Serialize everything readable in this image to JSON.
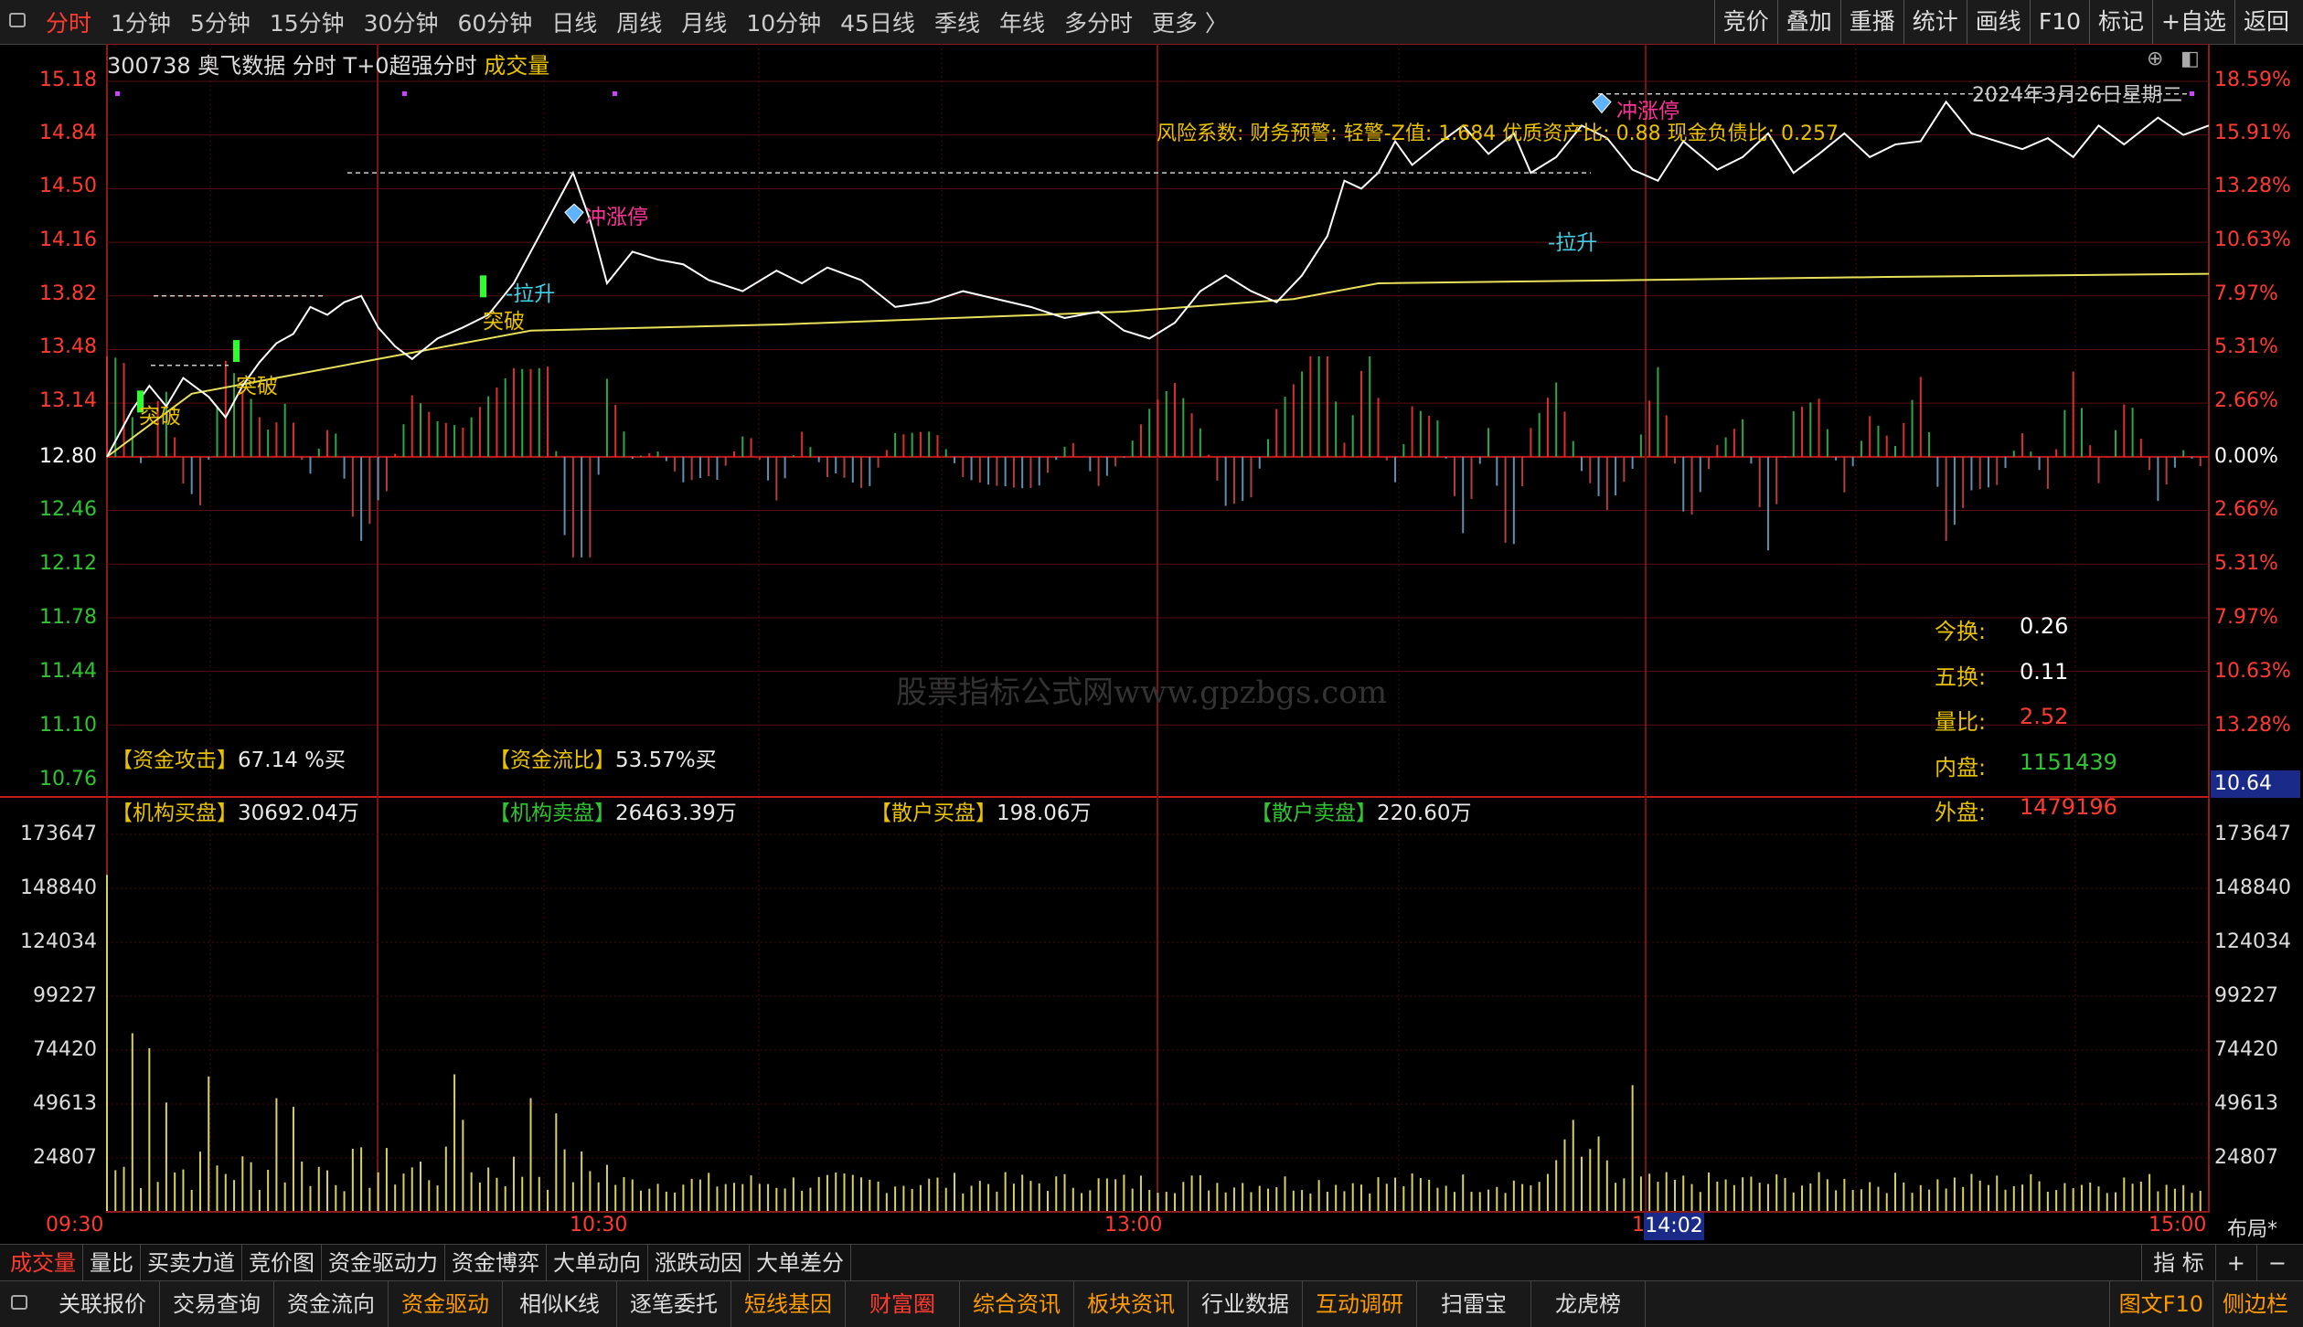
{
  "toolbar": {
    "periods": [
      "分时",
      "1分钟",
      "5分钟",
      "15分钟",
      "30分钟",
      "60分钟",
      "日线",
      "周线",
      "月线",
      "10分钟",
      "45日线",
      "季线",
      "年线",
      "多分时",
      "更多 〉"
    ],
    "active_period": 0,
    "right_tools": [
      "竞价",
      "叠加",
      "重播",
      "统计",
      "画线",
      "F10",
      "标记",
      "+自选",
      "返回"
    ]
  },
  "stock": {
    "code": "300738",
    "name": "奥飞数据",
    "mode": "分时 T+0超强分时",
    "indicator": "成交量"
  },
  "date": "2024年3月26日星期二",
  "risk_text": "风险系数: 财务预警: 轻警-Z值: 1.684 优质资产比: 0.88 现金负债比: 0.257",
  "price_axis": {
    "prices": [
      "15.18",
      "14.84",
      "14.50",
      "14.16",
      "13.82",
      "13.48",
      "13.14",
      "12.80",
      "12.46",
      "12.12",
      "11.78",
      "11.44",
      "11.10",
      "10.76"
    ],
    "percents": [
      "18.59%",
      "15.91%",
      "13.28%",
      "10.63%",
      "7.97%",
      "5.31%",
      "2.66%",
      "0.00%",
      "2.66%",
      "5.31%",
      "7.97%",
      "10.63%",
      "13.28%"
    ],
    "price_colors": {
      "up": "#ff3b30",
      "flat": "#ffffff",
      "down": "#31c431"
    }
  },
  "signals": [
    {
      "text": "突破",
      "color": "#e8c200"
    },
    {
      "text": "突破",
      "color": "#e8c200"
    },
    {
      "text": "突破",
      "color": "#e8c200"
    },
    {
      "text": "拉升",
      "color": "#3fd0e8"
    },
    {
      "text": "冲涨停",
      "color": "#ff3399"
    },
    {
      "text": "拉升",
      "color": "#3fd0e8"
    },
    {
      "text": "冲涨停",
      "color": "#ff3399"
    }
  ],
  "stats": [
    {
      "label": "今换:",
      "value": "0.26",
      "color": "#ffffff"
    },
    {
      "label": "五换:",
      "value": "0.11",
      "color": "#ffffff"
    },
    {
      "label": "量比:",
      "value": "2.52",
      "color": "#ff3b30"
    },
    {
      "label": "内盘:",
      "value": "1151439",
      "color": "#31c431"
    },
    {
      "label": "外盘:",
      "value": "1479196",
      "color": "#ff3b30"
    }
  ],
  "funds": {
    "attack": {
      "label": "【资金攻击】",
      "value": "67.14 %买"
    },
    "flow": {
      "label": "【资金流比】",
      "value": "53.57%买"
    },
    "inst_buy": {
      "label": "【机构买盘】",
      "value": "30692.04万"
    },
    "inst_sell": {
      "label": "【机构卖盘】",
      "value": "26463.39万"
    },
    "retail_buy": {
      "label": "【散户买盘】",
      "value": "198.06万"
    },
    "retail_sell": {
      "label": "【散户卖盘】",
      "value": "220.60万"
    }
  },
  "watermark": "股票指标公式网www.gpzbgs.com",
  "cursor": {
    "price": "10.64",
    "time": "14:02"
  },
  "volume_axis": [
    "173647",
    "148840",
    "124034",
    "99227",
    "74420",
    "49613",
    "24807"
  ],
  "time_axis": [
    "09:30",
    "10:30",
    "13:00",
    "1",
    "15:00"
  ],
  "layout_label": "布局*",
  "indicator_tabs": [
    "成交量",
    "量比",
    "买卖力道",
    "竞价图",
    "资金驱动力",
    "资金博弈",
    "大单动向",
    "涨跌动因",
    "大单差分"
  ],
  "indicator_right": [
    "指 标",
    "+",
    "−"
  ],
  "function_tabs": [
    {
      "label": "关联报价",
      "color": "#dddddd"
    },
    {
      "label": "交易查询",
      "color": "#dddddd"
    },
    {
      "label": "资金流向",
      "color": "#dddddd"
    },
    {
      "label": "资金驱动",
      "color": "#ff9b00"
    },
    {
      "label": "相似K线",
      "color": "#dddddd"
    },
    {
      "label": "逐笔委托",
      "color": "#dddddd"
    },
    {
      "label": "短线基因",
      "color": "#ff9b00"
    },
    {
      "label": "财富圈",
      "color": "#ff3b30"
    },
    {
      "label": "综合资讯",
      "color": "#ff9b00"
    },
    {
      "label": "板块资讯",
      "color": "#ff9b00"
    },
    {
      "label": "行业数据",
      "color": "#dddddd"
    },
    {
      "label": "互动调研",
      "color": "#ff9b00"
    },
    {
      "label": "扫雷宝",
      "color": "#dddddd"
    },
    {
      "label": "龙虎榜",
      "color": "#dddddd"
    }
  ],
  "function_right": [
    "图文F10",
    "侧边栏"
  ],
  "chart_data": {
    "type": "line",
    "prev_close": 12.8,
    "ylim": [
      10.76,
      15.18
    ],
    "price_series": [
      [
        0,
        12.8
      ],
      [
        6,
        13.1
      ],
      [
        10,
        13.25
      ],
      [
        14,
        13.12
      ],
      [
        18,
        13.3
      ],
      [
        24,
        13.18
      ],
      [
        28,
        13.05
      ],
      [
        32,
        13.25
      ],
      [
        36,
        13.4
      ],
      [
        40,
        13.52
      ],
      [
        44,
        13.58
      ],
      [
        48,
        13.75
      ],
      [
        52,
        13.7
      ],
      [
        56,
        13.78
      ],
      [
        60,
        13.82
      ],
      [
        64,
        13.62
      ],
      [
        68,
        13.5
      ],
      [
        72,
        13.42
      ],
      [
        78,
        13.55
      ],
      [
        84,
        13.62
      ],
      [
        90,
        13.7
      ],
      [
        96,
        13.9
      ],
      [
        100,
        14.1
      ],
      [
        104,
        14.3
      ],
      [
        108,
        14.5
      ],
      [
        110,
        14.6
      ],
      [
        114,
        14.3
      ],
      [
        118,
        13.9
      ],
      [
        124,
        14.1
      ],
      [
        130,
        14.05
      ],
      [
        136,
        14.02
      ],
      [
        142,
        13.92
      ],
      [
        150,
        13.85
      ],
      [
        158,
        13.98
      ],
      [
        164,
        13.9
      ],
      [
        170,
        14.0
      ],
      [
        178,
        13.92
      ],
      [
        186,
        13.75
      ],
      [
        194,
        13.78
      ],
      [
        202,
        13.85
      ],
      [
        210,
        13.8
      ],
      [
        218,
        13.75
      ],
      [
        226,
        13.68
      ],
      [
        234,
        13.72
      ],
      [
        240,
        13.6
      ],
      [
        246,
        13.55
      ],
      [
        252,
        13.65
      ],
      [
        258,
        13.85
      ],
      [
        264,
        13.95
      ],
      [
        270,
        13.85
      ],
      [
        276,
        13.78
      ],
      [
        282,
        13.95
      ],
      [
        288,
        14.2
      ],
      [
        292,
        14.55
      ],
      [
        296,
        14.5
      ],
      [
        300,
        14.6
      ],
      [
        304,
        14.8
      ],
      [
        308,
        14.65
      ],
      [
        314,
        14.78
      ],
      [
        320,
        14.9
      ],
      [
        326,
        14.72
      ],
      [
        332,
        14.85
      ],
      [
        336,
        14.6
      ],
      [
        342,
        14.7
      ],
      [
        348,
        14.9
      ],
      [
        354,
        14.82
      ],
      [
        360,
        14.62
      ],
      [
        366,
        14.55
      ],
      [
        372,
        14.8
      ],
      [
        380,
        14.62
      ],
      [
        386,
        14.7
      ],
      [
        392,
        14.85
      ],
      [
        398,
        14.6
      ],
      [
        404,
        14.72
      ],
      [
        410,
        14.85
      ],
      [
        416,
        14.7
      ],
      [
        422,
        14.78
      ],
      [
        428,
        14.8
      ],
      [
        434,
        15.05
      ],
      [
        440,
        14.85
      ],
      [
        446,
        14.8
      ],
      [
        452,
        14.75
      ],
      [
        458,
        14.82
      ],
      [
        464,
        14.7
      ],
      [
        470,
        14.9
      ],
      [
        476,
        14.78
      ],
      [
        484,
        14.95
      ],
      [
        490,
        14.84
      ],
      [
        496,
        14.9
      ]
    ],
    "avg_series": [
      [
        0,
        12.8
      ],
      [
        20,
        13.2
      ],
      [
        60,
        13.4
      ],
      [
        100,
        13.6
      ],
      [
        160,
        13.64
      ],
      [
        240,
        13.72
      ],
      [
        280,
        13.8
      ],
      [
        300,
        13.9
      ],
      [
        360,
        13.92
      ],
      [
        420,
        13.94
      ],
      [
        496,
        13.96
      ]
    ],
    "volume_axis_max": 173647
  }
}
